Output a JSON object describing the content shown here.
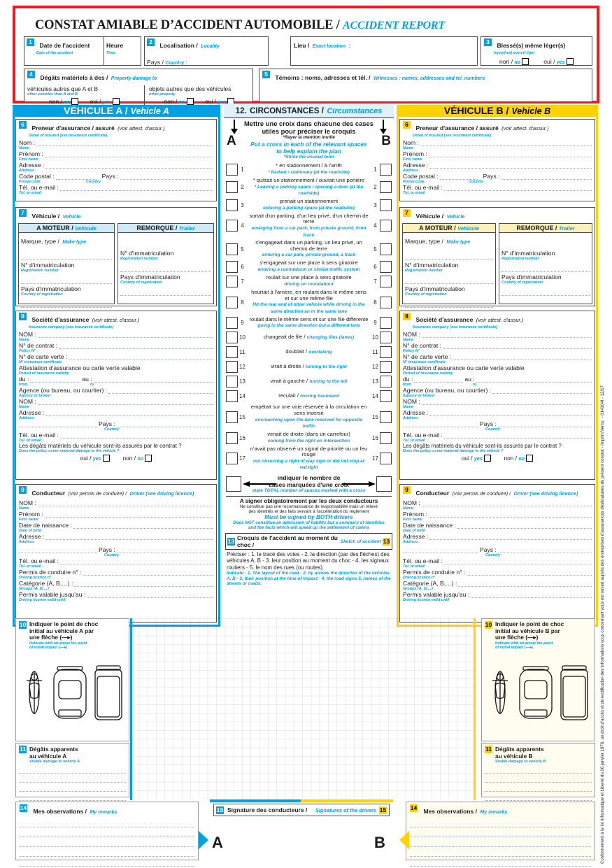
{
  "title": {
    "fr": "CONSTAT AMIABLE D’ACCIDENT AUTOMOBILE /",
    "en": "ACCIDENT REPORT"
  },
  "top": {
    "f1": {
      "num": "1",
      "fr": "Date de l'accident",
      "en": "Date of the accident",
      "hour_fr": "Heure",
      "hour_en": "Time"
    },
    "f2": {
      "num": "2",
      "fr": "Localisation /",
      "en": "Locality",
      "country_fr": "Pays /",
      "country_en": "Country",
      "country_colon": ":"
    },
    "place": {
      "fr": "Lieu /",
      "en": "Exact location",
      "colon": ":"
    },
    "f3": {
      "num": "3",
      "fr": "Blessé(s) même léger(s)",
      "en": "Injury(ies) even if light",
      "no_fr": "non /",
      "no_en": "no",
      "yes_fr": "oui /",
      "yes_en": "yes"
    },
    "f4": {
      "num": "4",
      "fr": "Dégâts matériels à des /",
      "en": "Property damage to",
      "left_fr": "véhicules autres que A et B",
      "left_en": "other vehicles than A and B",
      "right_fr": "objets autres que des véhicules",
      "right_en": "other property",
      "no_fr": "non /",
      "no_en": "no",
      "yes_fr": "oui /",
      "yes_en": "yes"
    },
    "f5": {
      "num": "5",
      "fr": "Témoins : noms, adresses et tél. /",
      "en": "Witnesses : names, addresses and tel. numbers"
    }
  },
  "vehicleA": {
    "head_fr": "VÉHICULE A /",
    "head_en": "Vehicle A"
  },
  "vehicleB": {
    "head_fr": "VÉHICULE B /",
    "head_en": "Vehicle B"
  },
  "s6": {
    "num": "6",
    "fr": "Preneur d'assurance / assuré",
    "fr_paren": "(voir attest. d'assur.)",
    "en": "Detail of insured (see insurance certificate)",
    "fields": [
      {
        "fr": "Nom :",
        "en": "Name"
      },
      {
        "fr": "Prénom :",
        "en": "First name"
      },
      {
        "fr": "Adresse :",
        "en": "Address"
      },
      {
        "fr": "Code postal :",
        "en": "Postal code",
        "fr2": "Pays :",
        "en2": "Country"
      },
      {
        "fr": "Tél. ou e-mail :",
        "en": "Tel. or email"
      }
    ]
  },
  "s7": {
    "num": "7",
    "fr": "Véhicule /",
    "en": "Vehicle",
    "col1_fr": "A MOTEUR /",
    "col1_en": "Vehicule",
    "col2_fr": "REMORQUE /",
    "col2_en": "Trailer",
    "make_fr": "Marque, type /",
    "make_en": "Make type",
    "reg_fr": "N° d'immatriculation",
    "reg_en": "Registration number",
    "country_fr": "Pays d'immatriculation",
    "country_en": "Country of registration"
  },
  "s8": {
    "num": "8",
    "fr": "Société d'assurance",
    "fr_paren": "(voir attest. d'assur.)",
    "en": "Insurance company (see insurance certificate)",
    "name_fr": "NOM :",
    "name_en": "Name",
    "policy_fr": "N° de contrat :",
    "policy_en": "Policy N°",
    "green_fr": "N° de carte verte :",
    "green_en": "N° insurance certificate",
    "valid_fr": "Attestation d'assurance ou carte verte valable",
    "valid_en": "Period of insurance validity",
    "from_fr": "du :",
    "from_en": "from",
    "to_fr": "au :",
    "to_en": "to",
    "agency_fr": "Agence (ou bureau, ou courtier) :",
    "agency_en": "Agency or broker",
    "ag_name_fr": "NOM :",
    "ag_name_en": "Name",
    "ag_addr_fr": "Adresse :",
    "ag_addr_en": "Address",
    "ag_country_fr": "Pays :",
    "ag_country_en": "Country",
    "tel_fr": "Tél. ou e-mail :",
    "tel_en": "Tel. or email",
    "q_fr": "Les dégâts matériels du véhicule sont-ils assurés par le contrat ?",
    "q_en": "Does the policy cover material damage to the vehicle ?",
    "yes_fr": "oui /",
    "yes_en": "yes",
    "no_fr": "non /",
    "no_en": "no"
  },
  "s9": {
    "num": "9",
    "fr": "Conducteur",
    "fr_paren": "(voir permis de conduire) /",
    "en": "Driver (see driving licence)",
    "name_fr": "NOM :",
    "name_en": "Name",
    "first_fr": "Prénom :",
    "first_en": "First name",
    "dob_fr": "Date de naissance :",
    "dob_en": "Date of birth",
    "addr_fr": "Adresse :",
    "addr_en": "Address",
    "country_fr": "Pays :",
    "country_en": "Country",
    "tel_fr": "Tél. ou e-mail :",
    "tel_en": "Tel. or email",
    "lic_fr": "Permis de conduire n° :",
    "lic_en": "Driving licence n°",
    "cat_fr": "Catégorie (A, B,…) :",
    "cat_en": "Groups (A, B,…)",
    "until_fr": "Permis valable jusqu'au :",
    "until_en": "Driving licence valid until"
  },
  "s10": {
    "num": "10",
    "fr1": "Indiquer le point de choc",
    "fr2a": "initial au véhicule A par",
    "fr2b": "initial au véhicule B par",
    "fr3": "une flèche (—▸)",
    "en1": "Indicate with an arrow the point",
    "en2": "of initial impact (—▸)"
  },
  "s11": {
    "num": "11",
    "fr1": "Dégâts apparents",
    "fr2a": "au véhicule A",
    "fr2b": "au véhicule B",
    "en_a": "Visible damage to vehicle A",
    "en_b": "Visible damage to vehicle B"
  },
  "s12": {
    "num": "12.",
    "fr": "CIRCONSTANCES /",
    "en": "Circumstances",
    "instr_fr1": "Mettre une croix dans chacune des cases",
    "instr_fr2": "utiles pour préciser le croquis",
    "instr_fr3": "*Rayer la mention inutile",
    "instr_en1": "Put a cross in each of the relevant spaces",
    "instr_en2": "to help explain the plan",
    "instr_en3": "*Strike the unused term",
    "colA": "A",
    "colB": "B",
    "items": [
      {
        "n": 1,
        "fr": "* en stationnement / à l'arrêt",
        "en": "* Parked / stationary (at the roadside)"
      },
      {
        "n": 2,
        "fr": "* quittait un stationnement / ouvrait une portière",
        "en": "* Leaving a parking space / opening a door (at the roadside)"
      },
      {
        "n": 3,
        "fr": "prenait un stationnement",
        "en": "entering a parking space (at the roadside)"
      },
      {
        "n": 4,
        "fr": "sortait d'un parking, d'un lieu privé, d'un chemin de terre",
        "en": "emerging from a car park, from private ground, from track"
      },
      {
        "n": 5,
        "fr": "s'engageait dans un parking, un lieu privé, un chemin de terre",
        "en": "entering a car park, private ground, a track"
      },
      {
        "n": 6,
        "fr": "s'engageait sur une place à sens giratoire",
        "en": "entering a roundabout or similar traffic system"
      },
      {
        "n": 7,
        "fr": "roulait sur une place à sens giratoire",
        "en": "driving on roundabout"
      },
      {
        "n": 8,
        "fr": "heurtait à l'arrière, en roulant dans le même sens et sur une même file",
        "en": "Hit the rear end of other vehicle while driving in the same direction an in the same lane"
      },
      {
        "n": 9,
        "fr": "roulait dans le même sens et sur une file différente",
        "en": "going in the same direction but a different lane"
      },
      {
        "n": 10,
        "fr": "changeait de file /",
        "en": "changing files (lanes)"
      },
      {
        "n": 11,
        "fr": "doublait /",
        "en": "overtaking"
      },
      {
        "n": 12,
        "fr": "virait à droite /",
        "en": "turning to the right"
      },
      {
        "n": 13,
        "fr": "virait à gauche /",
        "en": "turning to the left"
      },
      {
        "n": 14,
        "fr": "reculait /",
        "en": "moving backward"
      },
      {
        "n": 15,
        "fr": "empétait sur une voie réservée à la circulation en sens inverse",
        "en": "encroaching upon the lane reserved for opposite traffic"
      },
      {
        "n": 16,
        "fr": "venait de droite (dans un carrefour)",
        "en": "coming from the right on intersection"
      },
      {
        "n": 17,
        "fr": "n'avait pas observé un signal de priorité ou un feu rouge",
        "en": "not observing a right of way sign or did not stop at red light"
      }
    ],
    "total_fr1": "indiquer le nombre de",
    "total_fr2": "cases marquées d'une croix",
    "total_en": "state TOTAL number of spaces marked with a cross",
    "sign_fr1": "A signer obligatoirement par les deux conducteurs",
    "sign_fr2": "Ne constitue pas une reconnaissance de responsabilité mais un relevé",
    "sign_fr3": "des identités et des faits servant à l'accélération du règlement",
    "sign_en1": "Must be signed by BOTH drivers",
    "sign_en2": "Does NOT constitue an admission of liability but a summary of identities",
    "sign_en3": "and the facts which will speed up the settlement of claims"
  },
  "s13": {
    "num": "13",
    "fr": "Croquis de l'accident au moment du choc /",
    "en": "Sketch of accident",
    "detail_fr": "Préciser : 1. le tracé des voies - 2. la direction (par des flèches) des véhicules A, B - 3. leur position au moment du choc - 4. les signaux routiers - 5. le nom des rues (ou routes).",
    "detail_en": "Indicate : 1. The layout of the road - 2. by arrows the direction of the vehicles A, B - 3. their position at the time of impact - 4. the road signs 5. names of the streets or roads."
  },
  "s14": {
    "num": "14",
    "fr": "Mes observations /",
    "en": "My remarks"
  },
  "s15": {
    "num": "15",
    "fr": "Signature des conducteurs /",
    "en": "Signatures of the drivers",
    "a": "A",
    "b": "B"
  },
  "margin": "Conformément à la loi Informatique et Liberté du 06 janvier 1978, un droit d'accès et de rectification des informations vous concernant vous est ouvert auprès des entreprises d'assurances destinataires du présent constat - Imprim'Vert® - 014104I - 12/17",
  "colors": {
    "blue": "#00a0e3",
    "yellow": "#ffd200",
    "red": "#ed1c24"
  }
}
